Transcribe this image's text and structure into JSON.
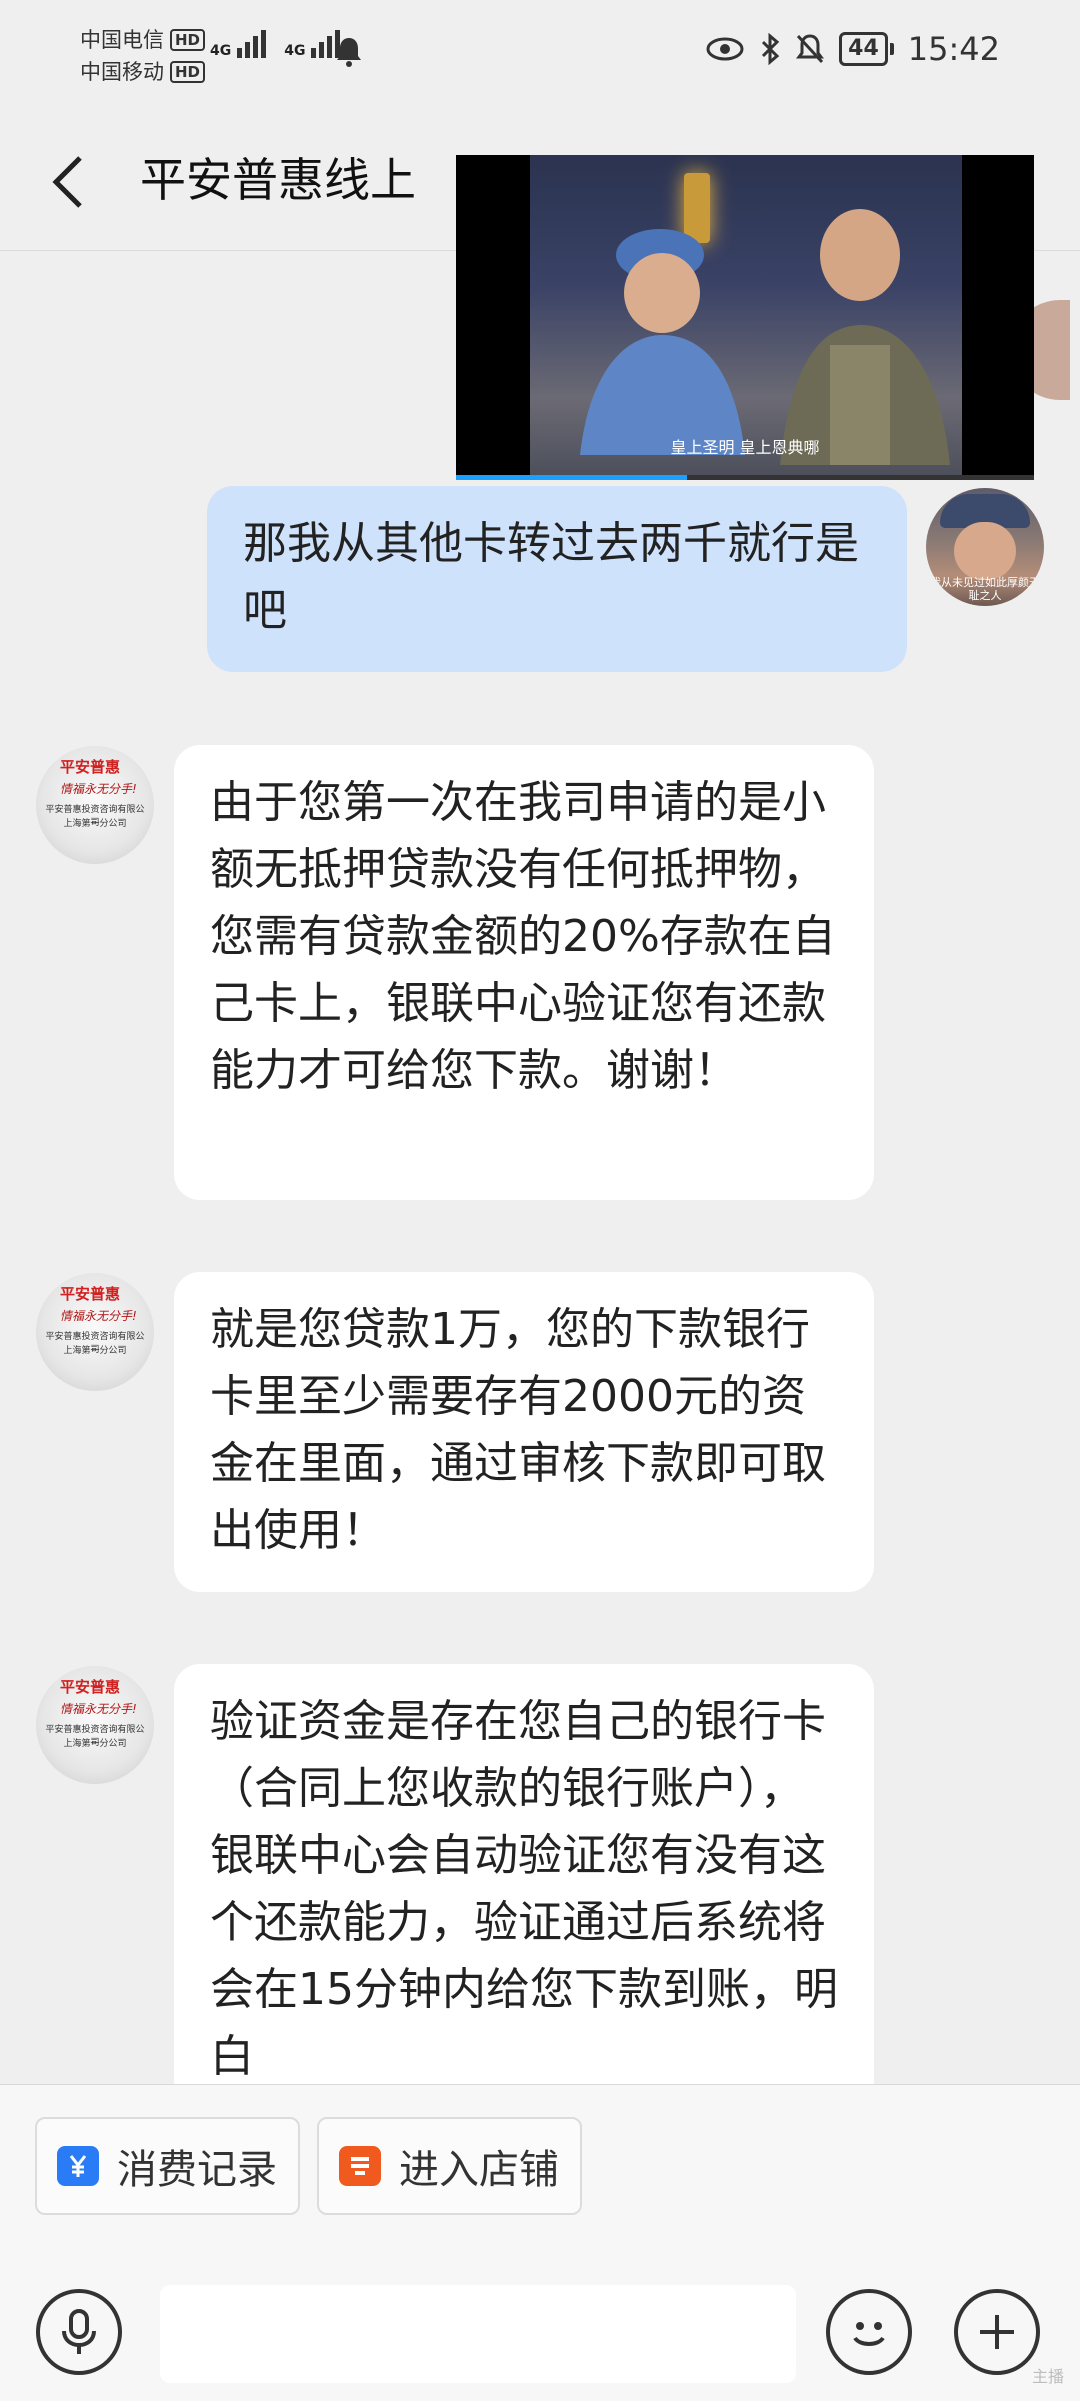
{
  "status": {
    "carrier1": "中国电信",
    "carrier2": "中国移动",
    "hd": "HD",
    "net1": "4G",
    "net2": "4G",
    "battery": "44",
    "time": "15:42"
  },
  "header": {
    "title": "平安普惠线上"
  },
  "video": {
    "subtitle": "皇上圣明  皇上恩典哪",
    "progress": 0.4
  },
  "messages": [
    {
      "from": "me",
      "text": "那我从其他卡转过去两千就行是吧",
      "avatar_caption": "我从未见过如此厚颜无耻之人"
    },
    {
      "from": "them",
      "text": "由于您第一次在我司申请的是小额无抵押贷款没有任何抵押物，您需有贷款金额的20%存款在自己卡上，银联中心验证您有还款能力才可给您下款。谢谢！"
    },
    {
      "from": "them",
      "text": " 就是您贷款1万，您的下款银行卡里至少需要存有2000元的资金在里面，通过审核下款即可取出使用！"
    },
    {
      "from": "them",
      "text": "验证资金是存在您自己的银行卡（合同上您收款的银行账户），银联中心会自动验证您有没有这个还款能力，验证通过后系统将会在15分钟内给您下款到账，明白"
    }
  ],
  "seal": {
    "logo": "平安普惠",
    "script": "情福永无分手!",
    "line1": "平安普惠投资咨询有限公司",
    "line2": "上海第一分公司"
  },
  "shortcuts": {
    "records": "消费记录",
    "store": "进入店铺",
    "records_icon_color": "#2a7bf6",
    "store_icon_color": "#f05a1e"
  },
  "watermark": "主播"
}
